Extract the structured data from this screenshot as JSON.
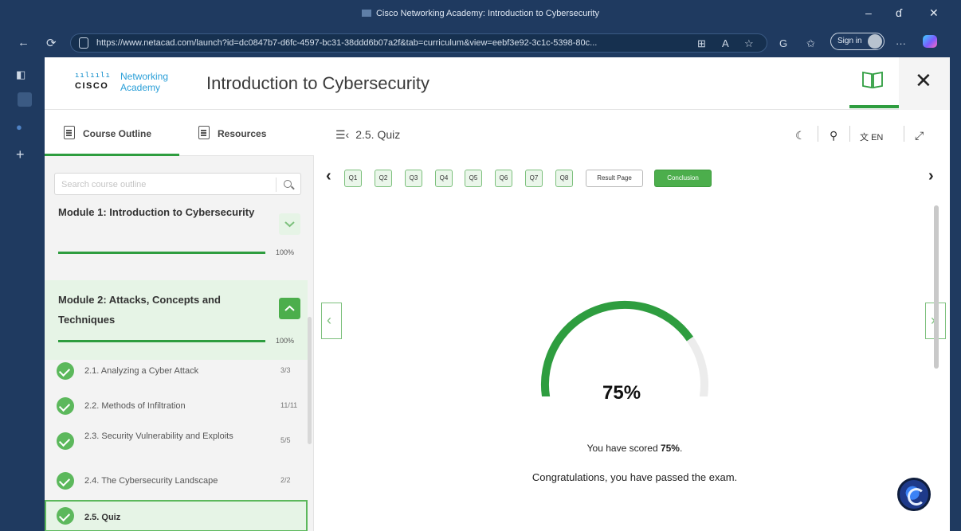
{
  "browser": {
    "window_title": "Cisco Networking Academy: Introduction to Cybersecurity",
    "url": "https://www.netacad.com/launch?id=dc0847b7-d6fc-4597-bc31-38ddd6b07a2f&tab=curriculum&view=eebf3e92-3c1c-5398-80c...",
    "sign_in_label": "Sign in",
    "controls": {
      "minimize": "–",
      "restore": "ɗ",
      "close": "✕"
    }
  },
  "header": {
    "logo_bars": "ıılıılı",
    "logo_word": "CISCO",
    "logo_brand_line1": "Networking",
    "logo_brand_line2": "Academy",
    "course_title": "Introduction to Cybersecurity",
    "close_label": "✕"
  },
  "sidebar": {
    "tabs": [
      {
        "label": "Course Outline"
      },
      {
        "label": "Resources"
      }
    ],
    "search_placeholder": "Search course outline",
    "modules": [
      {
        "title": "Module 1: Introduction to Cybersecurity",
        "progress": "100%",
        "expanded": false
      },
      {
        "title": "Module 2: Attacks, Concepts and Techniques",
        "progress": "100%",
        "expanded": true
      }
    ],
    "lessons": [
      {
        "title": "2.1. Analyzing a Cyber Attack",
        "count": "3/3"
      },
      {
        "title": "2.2. Methods of Infiltration",
        "count": "11/11"
      },
      {
        "title": "2.3. Security Vulnerability and Exploits",
        "count": "5/5"
      },
      {
        "title": "2.4. The Cybersecurity Landscape",
        "count": "2/2"
      },
      {
        "title": "2.5. Quiz",
        "count": ""
      }
    ]
  },
  "content": {
    "breadcrumb": "2.5. Quiz",
    "lang_label": "EN",
    "question_chips": [
      "Q1",
      "Q2",
      "Q3",
      "Q4",
      "Q5",
      "Q6",
      "Q7",
      "Q8"
    ],
    "result_page_label": "Result Page",
    "conclusion_label": "Conclusion",
    "score_value": 0.75,
    "score_text": "75%",
    "scored_prefix": "You have scored ",
    "scored_value": "75%",
    "scored_suffix": ".",
    "congrats": "Congratulations, you have passed the exam.",
    "colors": {
      "accent": "#2e9d3f",
      "chip_correct": "#eaf6ea",
      "gauge_track": "#ececec"
    }
  }
}
